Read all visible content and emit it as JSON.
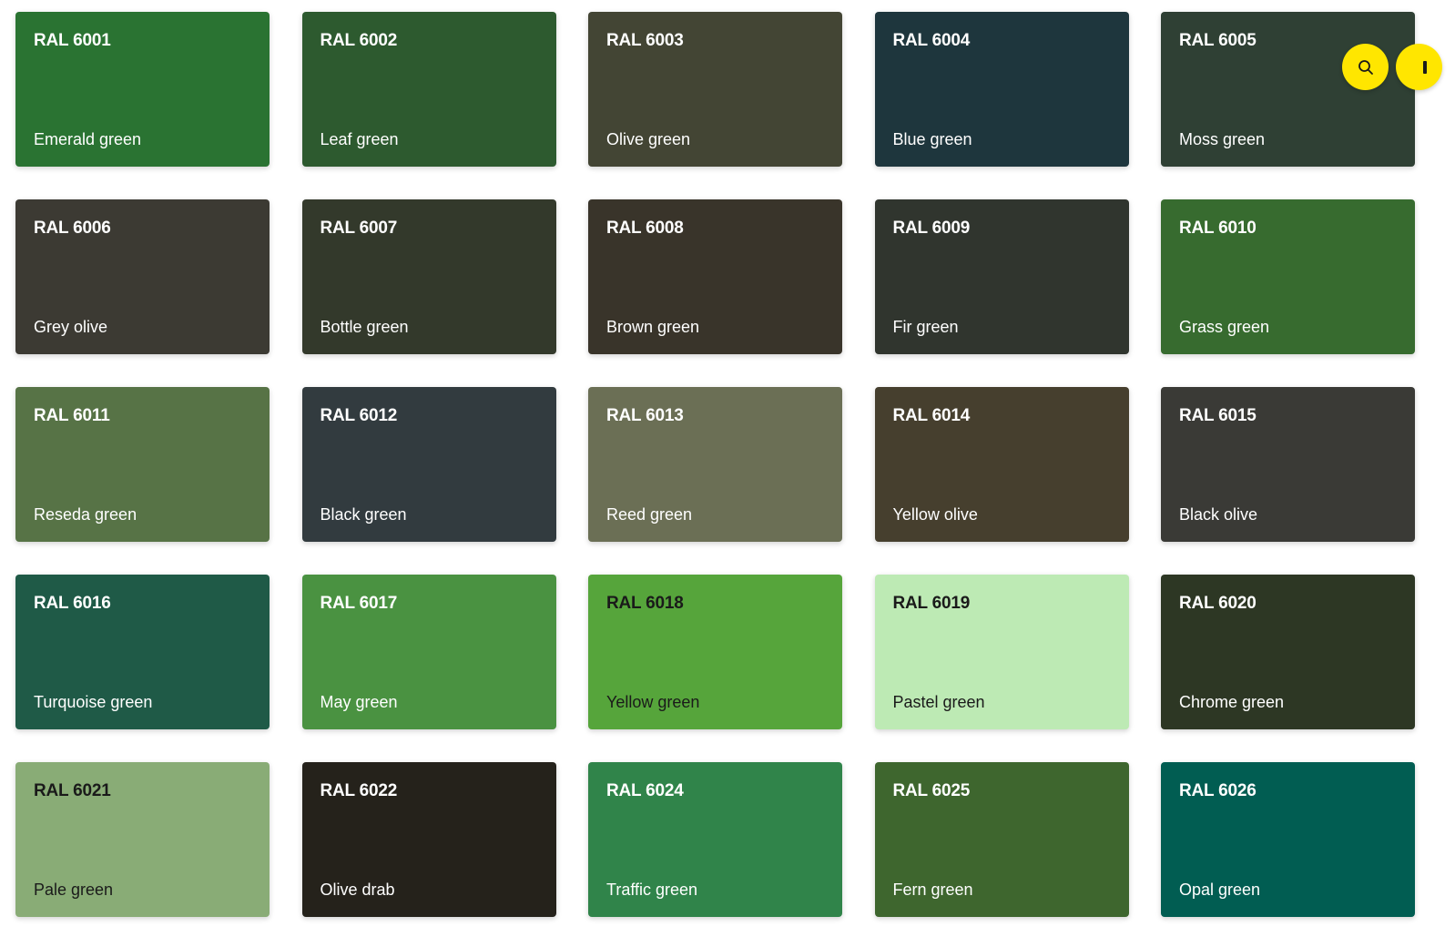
{
  "swatches": [
    {
      "code": "RAL 6001",
      "name": "Emerald green",
      "color": "#2a7332",
      "text": "dark"
    },
    {
      "code": "RAL 6002",
      "name": "Leaf green",
      "color": "#2d5a2f",
      "text": "dark"
    },
    {
      "code": "RAL 6003",
      "name": "Olive green",
      "color": "#434534",
      "text": "dark"
    },
    {
      "code": "RAL 6004",
      "name": "Blue green",
      "color": "#1e363d",
      "text": "dark"
    },
    {
      "code": "RAL 6005",
      "name": "Moss green",
      "color": "#2f4034",
      "text": "dark"
    },
    {
      "code": "RAL 6006",
      "name": "Grey olive",
      "color": "#3c3a33",
      "text": "dark"
    },
    {
      "code": "RAL 6007",
      "name": "Bottle green",
      "color": "#33392b",
      "text": "dark"
    },
    {
      "code": "RAL 6008",
      "name": "Brown green",
      "color": "#39342a",
      "text": "dark"
    },
    {
      "code": "RAL 6009",
      "name": "Fir green",
      "color": "#30352e",
      "text": "dark"
    },
    {
      "code": "RAL 6010",
      "name": "Grass green",
      "color": "#376b2f",
      "text": "dark"
    },
    {
      "code": "RAL 6011",
      "name": "Reseda green",
      "color": "#577346",
      "text": "dark"
    },
    {
      "code": "RAL 6012",
      "name": "Black green",
      "color": "#323b3f",
      "text": "dark"
    },
    {
      "code": "RAL 6013",
      "name": "Reed green",
      "color": "#6b6f55",
      "text": "dark"
    },
    {
      "code": "RAL 6014",
      "name": "Yellow olive",
      "color": "#463f2e",
      "text": "dark"
    },
    {
      "code": "RAL 6015",
      "name": "Black olive",
      "color": "#3a3a36",
      "text": "dark"
    },
    {
      "code": "RAL 6016",
      "name": "Turquoise green",
      "color": "#1f5a47",
      "text": "dark"
    },
    {
      "code": "RAL 6017",
      "name": "May green",
      "color": "#4a9241",
      "text": "dark"
    },
    {
      "code": "RAL 6018",
      "name": "Yellow green",
      "color": "#56a53b",
      "text": "light"
    },
    {
      "code": "RAL 6019",
      "name": "Pastel green",
      "color": "#bdeab4",
      "text": "light"
    },
    {
      "code": "RAL 6020",
      "name": "Chrome green",
      "color": "#2d3724",
      "text": "dark"
    },
    {
      "code": "RAL 6021",
      "name": "Pale green",
      "color": "#89ac76",
      "text": "light"
    },
    {
      "code": "RAL 6022",
      "name": "Olive drab",
      "color": "#25221b",
      "text": "dark"
    },
    {
      "code": "RAL 6024",
      "name": "Traffic green",
      "color": "#30844a",
      "text": "dark"
    },
    {
      "code": "RAL 6025",
      "name": "Fern green",
      "color": "#3e662e",
      "text": "dark"
    },
    {
      "code": "RAL 6026",
      "name": "Opal green",
      "color": "#015d52",
      "text": "dark"
    }
  ],
  "actions": {
    "search_icon": "search-icon",
    "accent_color": "#ffe600"
  }
}
